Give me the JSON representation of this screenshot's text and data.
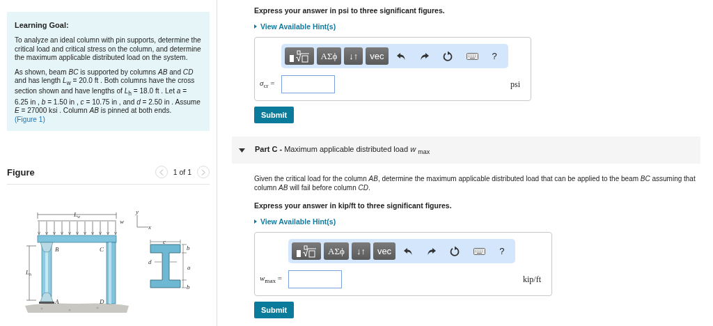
{
  "learning_goal": {
    "title": "Learning Goal:",
    "paragraphs": [
      "To analyze an ideal column with pin supports, determine the critical load and critical stress on the column, and determine the maximum applicable distributed load on the system.",
      "As shown, beam *BC* is supported by columns *AB* and *CD* and has length *L*$_{w}$ = 20.0 ft . Both columns have the cross section shown and have lengths of *L*$_{h}$ = 18.0 ft . Let *a* = 6.25 in , *b* = 1.50 in , *c* = 10.75 in , and *d* = 2.50 in . Assume *E* = 27000 ksi . Column *AB* is pinned at both ends."
    ],
    "figure_link": "(Figure 1)"
  },
  "figure": {
    "title": "Figure",
    "pager": "1 of 1",
    "labels": [
      {
        "text": "L",
        "sub": "w"
      },
      {
        "text": "w"
      },
      {
        "text": "y"
      },
      {
        "text": "x"
      },
      {
        "text": "B"
      },
      {
        "text": "C"
      },
      {
        "text": "A"
      },
      {
        "text": "D"
      },
      {
        "text": "L",
        "sub": "h"
      },
      {
        "text": "c"
      },
      {
        "text": "d"
      },
      {
        "text": "b"
      },
      {
        "text": "a"
      },
      {
        "text": "b"
      }
    ]
  },
  "parts": [
    {
      "instruction": "Express your answer in psi to three significant figures.",
      "hint": "View Available Hint(s)",
      "answer": {
        "label": "*σ*$_{cr}$ =",
        "unit": "psi",
        "toolbar": [
          {
            "kind": "template"
          },
          {
            "kind": "text",
            "label": "ΑΣϕ"
          },
          {
            "kind": "text",
            "label": "↓↑"
          },
          {
            "kind": "text",
            "label": "vec"
          },
          {
            "kind": "undo"
          },
          {
            "kind": "redo"
          },
          {
            "kind": "reset"
          },
          {
            "kind": "keyboard"
          },
          {
            "kind": "help",
            "label": "?"
          }
        ]
      },
      "submit": "Submit"
    },
    {
      "header": "**Part C -** Maximum applicable distributed load *w* $_{max}$",
      "expanded": true,
      "question": "Given the critical load for the column *AB*, determine the maximum applicable distributed load that can be applied to the beam *BC* assuming that column *AB* will fail before column *CD*.",
      "instruction": "Express your answer in kip/ft to three significant figures.",
      "hint": "View Available Hint(s)",
      "answer": {
        "label": "*w*$_{max}$ =",
        "unit": "kip/ft",
        "toolbar": [
          {
            "kind": "template"
          },
          {
            "kind": "text",
            "label": "ΑΣϕ"
          },
          {
            "kind": "text",
            "label": "↓↑"
          },
          {
            "kind": "text",
            "label": "vec"
          },
          {
            "kind": "undo"
          },
          {
            "kind": "redo"
          },
          {
            "kind": "reset"
          },
          {
            "kind": "keyboard"
          },
          {
            "kind": "help",
            "label": "?"
          }
        ]
      },
      "submit": "Submit"
    }
  ]
}
